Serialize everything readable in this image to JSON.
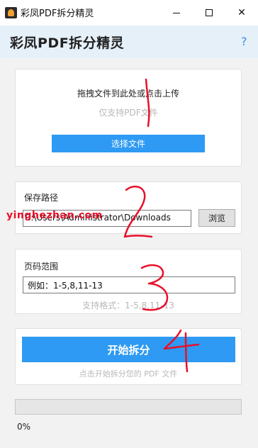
{
  "window": {
    "title": "彩凤PDF拆分精灵",
    "minimize_glyph": "",
    "maximize_glyph": "",
    "close_glyph": "✕"
  },
  "header": {
    "title": "彩凤PDF拆分精灵",
    "help_label": "?"
  },
  "upload": {
    "title": "拖拽文件到此处或点击上传",
    "hint": "仅支持PDF文件",
    "choose_button": "选择文件"
  },
  "save_path": {
    "label": "保存路径",
    "value": "C:\\Users\\Administrator\\Downloads",
    "browse_button": "浏览"
  },
  "page_range": {
    "label": "页码范围",
    "value": "例如：1-5,8,11-13",
    "hint": "支持格式：1-5,8,11-13"
  },
  "start": {
    "button": "开始拆分",
    "hint": "点击开始拆分您的 PDF 文件"
  },
  "progress": {
    "value": 0,
    "text": "0%"
  },
  "overlay": {
    "watermark": "yinghezhan.com",
    "annotation_color": "#e8102a",
    "annotation_numbers": [
      "1",
      "2",
      "3",
      "4"
    ]
  },
  "colors": {
    "accent": "#2e9af3",
    "header_bg": "#e6f0f9"
  }
}
